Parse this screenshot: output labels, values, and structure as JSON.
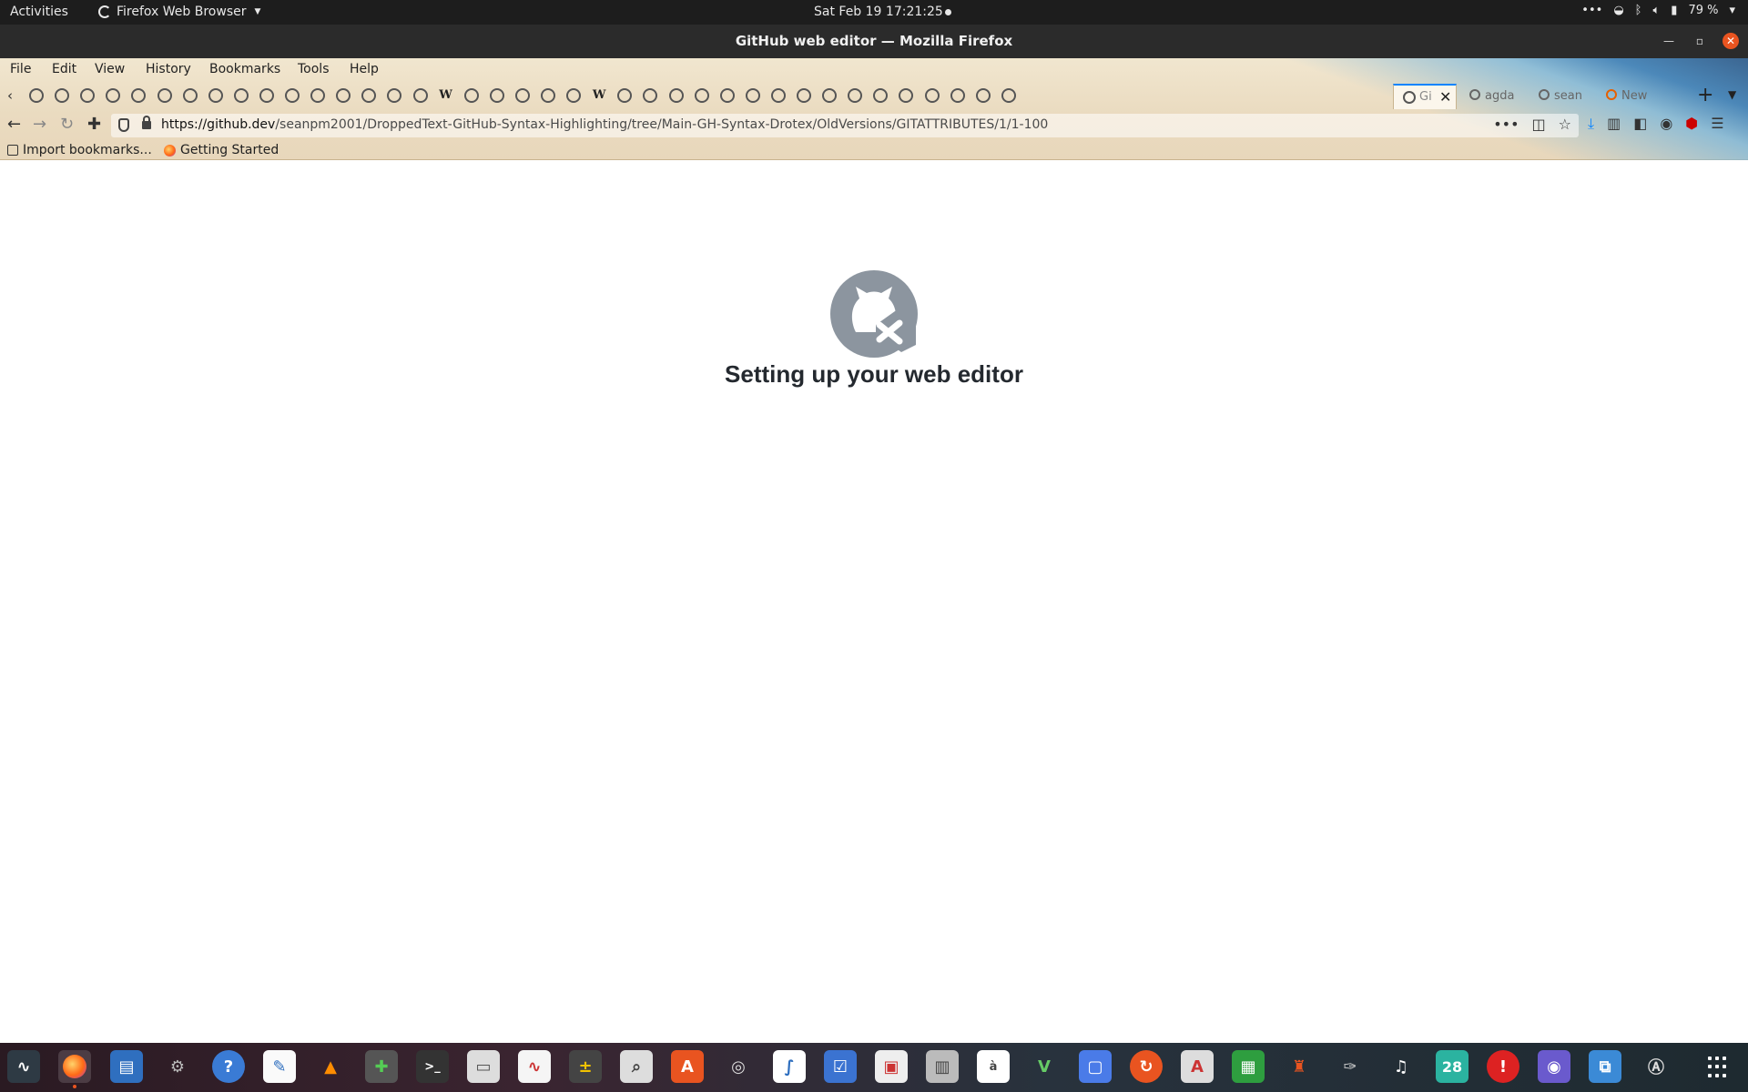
{
  "topbar": {
    "activities": "Activities",
    "app_name": "Firefox Web Browser",
    "clock": "Sat Feb 19  17:21:25",
    "battery": "79 %"
  },
  "window": {
    "title": "GitHub web editor — Mozilla Firefox"
  },
  "menu": [
    "File",
    "Edit",
    "View",
    "History",
    "Bookmarks",
    "Tools",
    "Help"
  ],
  "tabs": {
    "pinned_icons": [
      "github-icon",
      "github-icon",
      "github-icon",
      "github-icon",
      "github-icon",
      "github-icon",
      "github-icon",
      "github-icon",
      "github-icon",
      "github-icon",
      "github-icon",
      "github-icon",
      "github-icon",
      "github-icon",
      "github-icon",
      "github-icon",
      "wikipedia-icon",
      "github-icon",
      "github-icon",
      "github-icon",
      "github-icon",
      "github-icon",
      "wikipedia-icon",
      "github-icon",
      "github-icon",
      "github-icon",
      "github-icon",
      "github-icon",
      "github-icon",
      "github-icon",
      "github-icon",
      "github-icon",
      "github-icon",
      "github-icon",
      "github-icon",
      "github-icon",
      "github-icon",
      "github-icon",
      "github-icon"
    ],
    "wiki_glyph": "W",
    "active": {
      "label": "Gi",
      "close": "✕"
    },
    "others": [
      "agda",
      "sean",
      "New"
    ]
  },
  "navbar": {
    "url_host": "https://github.dev",
    "url_path": "/seanpm2001/DroppedText-GitHub-Syntax-Highlighting/tree/Main-GH-Syntax-Drotex/OldVersions/GITATTRIBUTES/1/1-100"
  },
  "bookmarks": [
    "Import bookmarks...",
    "Getting Started"
  ],
  "content": {
    "heading": "Setting up your web editor"
  },
  "dock": {
    "calendar_day": "28"
  },
  "colors": {
    "accent": "#e95420",
    "heading": "#24292f",
    "logo": "#8c959f"
  }
}
